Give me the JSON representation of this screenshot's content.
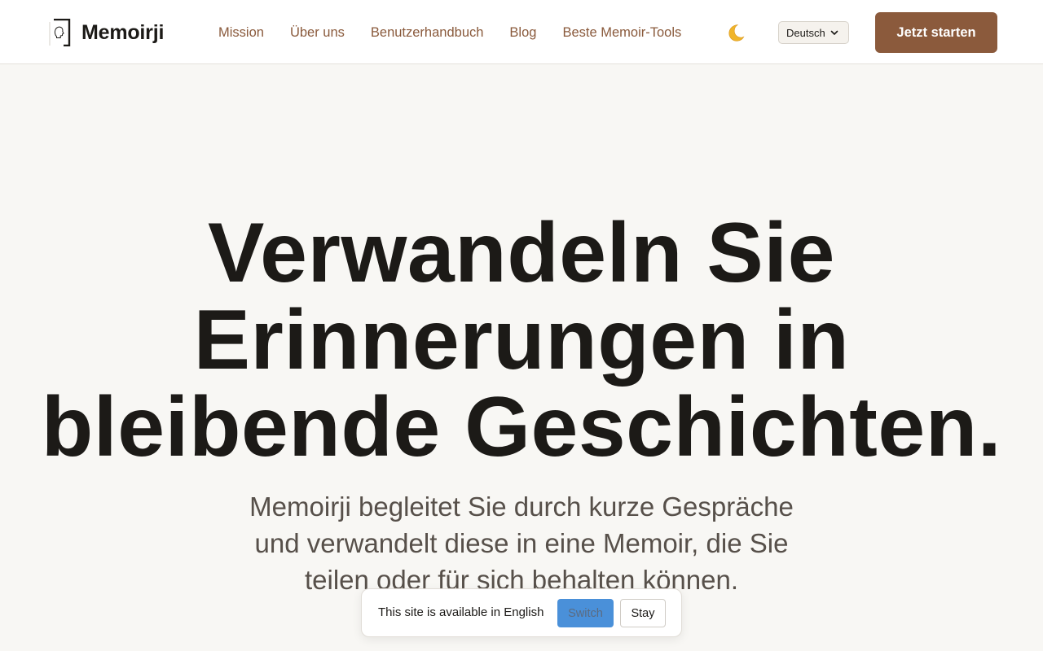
{
  "header": {
    "logo_text": "Memoirji",
    "nav": [
      {
        "label": "Mission"
      },
      {
        "label": "Über uns"
      },
      {
        "label": "Benutzerhandbuch"
      },
      {
        "label": "Blog"
      },
      {
        "label": "Beste Memoir-Tools"
      }
    ],
    "theme_toggle_icon": "moon-icon",
    "language_select": {
      "selected": "Deutsch"
    },
    "cta_label": "Jetzt starten"
  },
  "hero": {
    "title_lines": [
      "Verwandeln Sie",
      "Erinnerungen in",
      "bleibende Geschichten."
    ],
    "subtitle_lines": [
      "Memoirji begleitet Sie durch kurze Gespräche",
      "und verwandelt diese in eine Memoir, die Sie",
      "teilen oder für sich behalten können."
    ]
  },
  "language_banner": {
    "message": "This site is available in English",
    "switch_label": "Switch",
    "stay_label": "Stay"
  },
  "colors": {
    "accent": "#8b5a3c",
    "nav_link": "#8a5a3c",
    "background": "#f8f7f4",
    "switch_button": "#4a90d9"
  }
}
